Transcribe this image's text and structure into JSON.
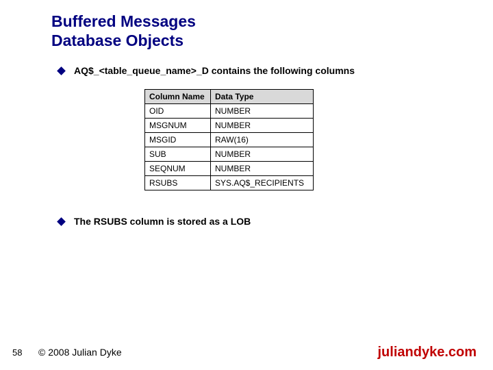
{
  "title_line1": "Buffered Messages",
  "title_line2": "Database Objects",
  "bullets": {
    "b1": "AQ$_<table_queue_name>_D contains the following columns",
    "b2": "The RSUBS column is stored as a LOB"
  },
  "table": {
    "headers": [
      "Column Name",
      "Data Type"
    ],
    "rows": [
      [
        "OID",
        "NUMBER"
      ],
      [
        "MSGNUM",
        "NUMBER"
      ],
      [
        "MSGID",
        "RAW(16)"
      ],
      [
        "SUB",
        "NUMBER"
      ],
      [
        "SEQNUM",
        "NUMBER"
      ],
      [
        "RSUBS",
        "SYS.AQ$_RECIPIENTS"
      ]
    ]
  },
  "footer": {
    "slidenum": "58",
    "copyright": "© 2008 Julian Dyke",
    "site": "juliandyke.com"
  }
}
